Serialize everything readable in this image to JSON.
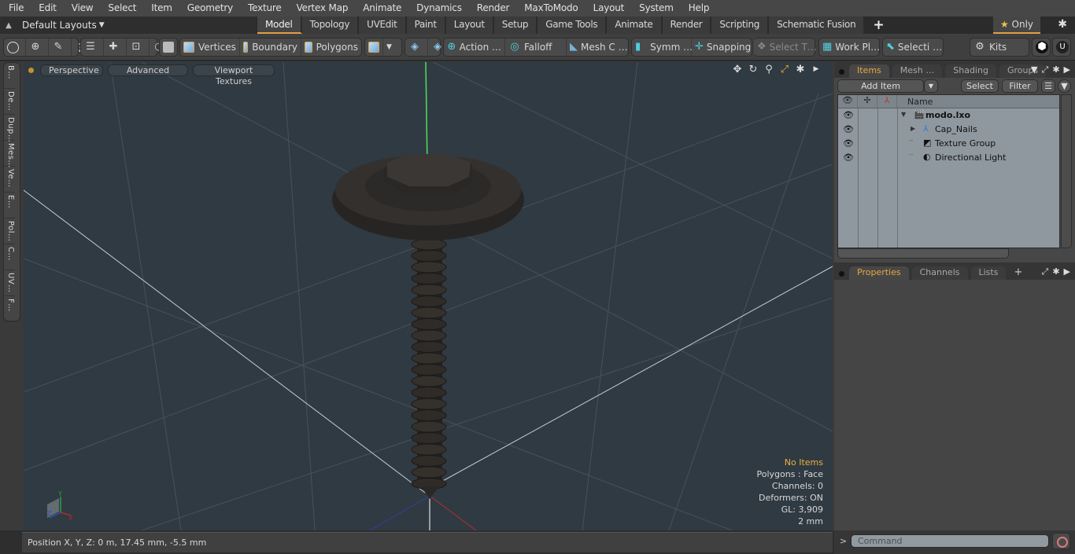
{
  "menu": [
    "File",
    "Edit",
    "View",
    "Select",
    "Item",
    "Geometry",
    "Texture",
    "Vertex Map",
    "Animate",
    "Dynamics",
    "Render",
    "MaxToModo",
    "Layout",
    "System",
    "Help"
  ],
  "layout_selector": {
    "label": "Default Layouts",
    "icon": "chevron-up-icon"
  },
  "tabs": [
    {
      "label": "Model",
      "active": true
    },
    {
      "label": "Topology"
    },
    {
      "label": "UVEdit"
    },
    {
      "label": "Paint"
    },
    {
      "label": "Layout"
    },
    {
      "label": "Setup"
    },
    {
      "label": "Game Tools"
    },
    {
      "label": "Animate"
    },
    {
      "label": "Render"
    },
    {
      "label": "Scripting"
    },
    {
      "label": "Schematic Fusion"
    }
  ],
  "tab_add": "+",
  "only_button": {
    "star": "★",
    "label": "Only"
  },
  "toolbar": {
    "vertices": "Vertices",
    "boundary": "Boundary",
    "polygons": "Polygons",
    "action": "Action   …",
    "falloff": "Falloff",
    "mesh_c": "Mesh C …",
    "symm": "Symm …",
    "snapping": "Snapping",
    "select_t": "Select T…",
    "work_pl": "Work Pl…",
    "selecti": "Selecti …",
    "kits": "Kits"
  },
  "viewport": {
    "buttons": [
      "Perspective",
      "Advanced",
      "Viewport Textures"
    ],
    "info": {
      "selection": "No Items",
      "polygons": "Polygons : Face",
      "channels": "Channels: 0",
      "deformers": "Deformers: ON",
      "gl": "GL: 3,909",
      "scale": "2 mm"
    },
    "axis_labels": {
      "x": "X",
      "y": "Y",
      "z": "Z"
    },
    "accent_color": "#e8b040"
  },
  "left_tabs": [
    "B…",
    "De…",
    "Dup…",
    "Mes…",
    "Ve…",
    "E…",
    "Pol…",
    "C…",
    "UV…",
    "F…"
  ],
  "status": {
    "position": "Position X, Y, Z:   0 m, 17.45 mm, -5.5 mm"
  },
  "items_panel": {
    "tabs": [
      {
        "label": "Items",
        "active": true
      },
      {
        "label": "Mesh …"
      },
      {
        "label": "Shading"
      },
      {
        "label": "Groups"
      }
    ],
    "add_item": "Add Item",
    "select": "Select",
    "filter": "Filter",
    "column_name": "Name",
    "rows": [
      {
        "name": "modo.lxo",
        "bold": true,
        "icon": "scene-clapper-icon",
        "expander": "▼"
      },
      {
        "name": "Cap_Nails",
        "icon": "locator-axes-icon",
        "expander": "▶"
      },
      {
        "name": "Texture Group",
        "icon": "texture-group-icon"
      },
      {
        "name": "Directional Light",
        "icon": "directional-light-icon"
      }
    ]
  },
  "properties_panel": {
    "tabs": [
      {
        "label": "Properties",
        "active": true
      },
      {
        "label": "Channels"
      },
      {
        "label": "Lists"
      }
    ],
    "add": "+"
  },
  "command": {
    "prompt": ">",
    "placeholder": "Command"
  }
}
